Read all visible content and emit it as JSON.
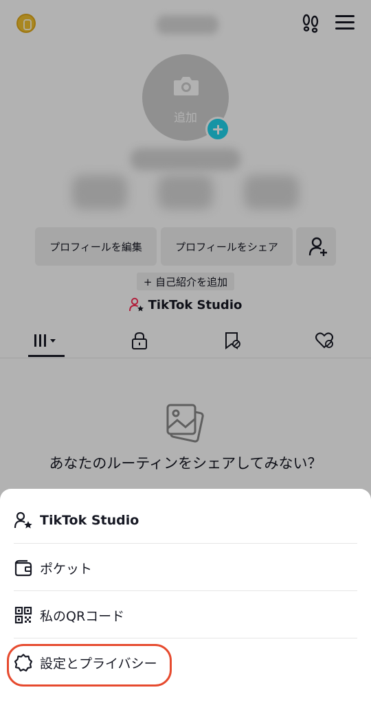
{
  "profile": {
    "avatar_label": "追加",
    "buttons": {
      "edit_profile": "プロフィールを編集",
      "share_profile": "プロフィールをシェア"
    },
    "bio_chip": "+ 自己紹介を追加",
    "studio_link": "TikTok Studio",
    "empty_state": "あなたのルーティンをシェアしてみない？"
  },
  "sheet": {
    "items": [
      {
        "label": "TikTok Studio",
        "icon": "person-star-icon"
      },
      {
        "label": "ポケット",
        "icon": "wallet-icon"
      },
      {
        "label": "私のQRコード",
        "icon": "qr-code-icon"
      },
      {
        "label": "設定とプライバシー",
        "icon": "gear-icon"
      }
    ]
  },
  "colors": {
    "accent_teal": "#20d5ec",
    "highlight_red": "#e64a2e",
    "studio_icon_pink": "#fe2c55"
  }
}
